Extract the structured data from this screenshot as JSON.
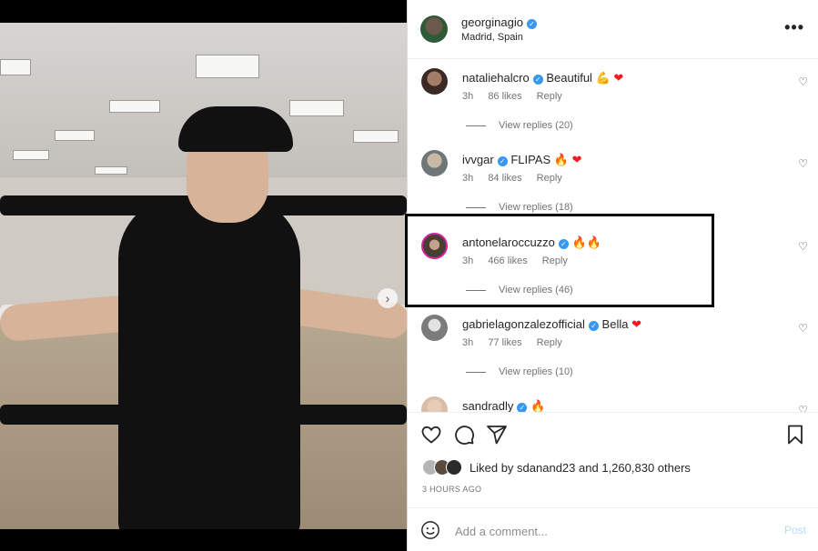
{
  "post": {
    "author": {
      "username": "georginagio",
      "location": "Madrid, Spain"
    },
    "carousel": {
      "next_icon": "›"
    },
    "more_icon": "•••"
  },
  "comments": [
    {
      "username": "nataliehalcro",
      "text": "Beautiful",
      "emoji": [
        "💪",
        "❤"
      ],
      "time": "3h",
      "likes": "86 likes",
      "reply": "Reply",
      "view_replies": "View replies (20)"
    },
    {
      "username": "ivvgar",
      "text": "FLIPAS",
      "emoji": [
        "🔥",
        "❤"
      ],
      "time": "3h",
      "likes": "84 likes",
      "reply": "Reply",
      "view_replies": "View replies (18)"
    },
    {
      "username": "antonelaroccuzzo",
      "text": "",
      "emoji": [
        "🔥",
        "🔥"
      ],
      "time": "3h",
      "likes": "466 likes",
      "reply": "Reply",
      "view_replies": "View replies (46)"
    },
    {
      "username": "gabrielagonzalezofficial",
      "text": "Bella",
      "emoji": [
        "❤"
      ],
      "time": "3h",
      "likes": "77 likes",
      "reply": "Reply",
      "view_replies": "View replies (10)"
    },
    {
      "username": "sandradly",
      "text": "",
      "emoji": [
        "🔥"
      ],
      "time": "",
      "likes": "",
      "reply": "",
      "view_replies": ""
    }
  ],
  "likes": {
    "prefix": "Liked by",
    "user": "sdanand23",
    "and": "and",
    "count": "1,260,830 others"
  },
  "time_ago": "3 HOURS AGO",
  "add_comment": {
    "placeholder": "Add a comment...",
    "post_label": "Post"
  },
  "colors": {
    "verified": "#3897f0",
    "post_disabled": "#b3dbff",
    "meta_gray": "#737373"
  }
}
